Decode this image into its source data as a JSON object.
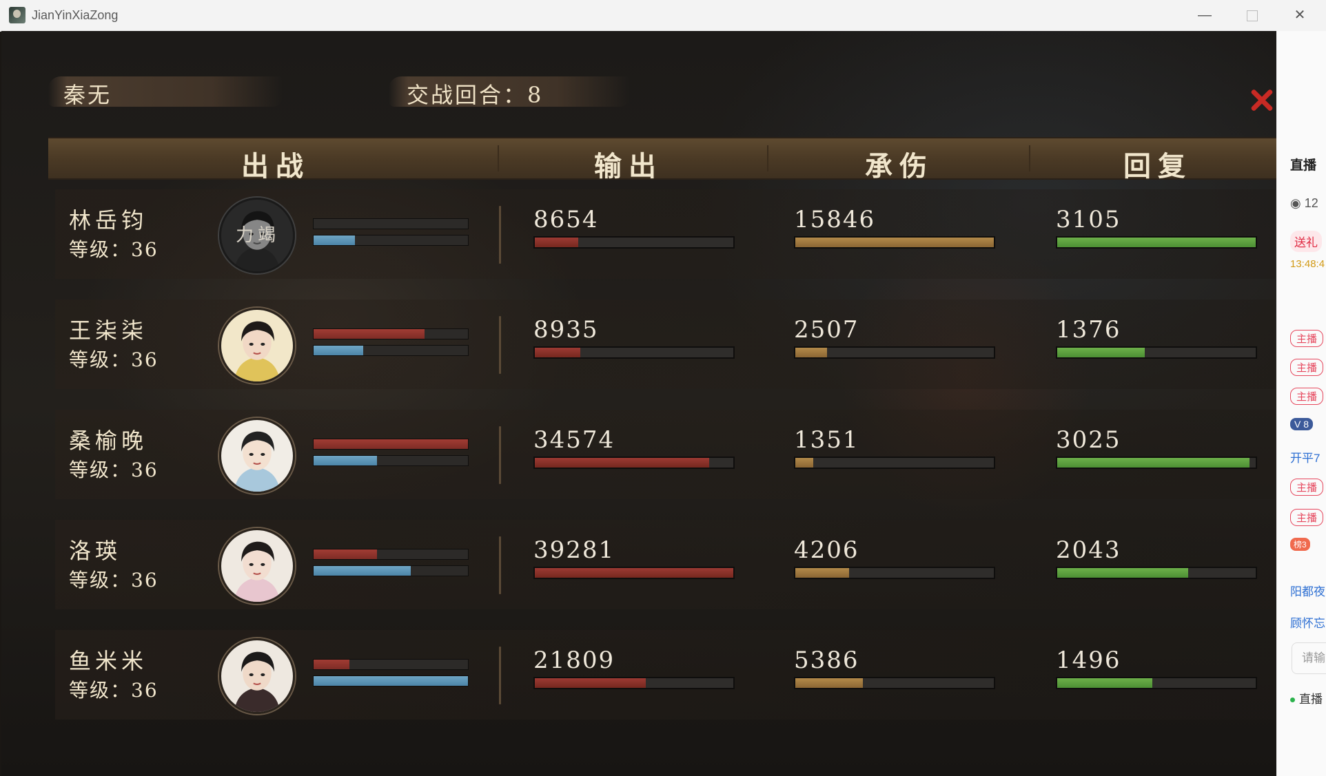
{
  "window": {
    "title": "JianYinXiaZong",
    "minimize": "—",
    "close": "✕"
  },
  "header": {
    "player_name": "秦无",
    "round_label": "交战回合：",
    "round_value": "8"
  },
  "columns": {
    "deploy": "出战",
    "output": "输出",
    "damage_taken": "承伤",
    "healing": "回复"
  },
  "rows": [
    {
      "name": "林岳钧",
      "level": "等级：36",
      "avatar_text": "力竭",
      "hp": 0.0,
      "mp": 0.27,
      "output": "8654",
      "output_pct": 0.22,
      "taken": "15846",
      "taken_pct": 1.0,
      "heal": "3105",
      "heal_pct": 1.0
    },
    {
      "name": "王柒柒",
      "level": "等级：36",
      "avatar_text": "",
      "hp": 0.72,
      "mp": 0.32,
      "output": "8935",
      "output_pct": 0.23,
      "taken": "2507",
      "taken_pct": 0.16,
      "heal": "1376",
      "heal_pct": 0.44
    },
    {
      "name": "桑榆晚",
      "level": "等级：36",
      "avatar_text": "",
      "hp": 1.0,
      "mp": 0.41,
      "output": "34574",
      "output_pct": 0.88,
      "taken": "1351",
      "taken_pct": 0.09,
      "heal": "3025",
      "heal_pct": 0.97
    },
    {
      "name": "洛瑛",
      "level": "等级：36",
      "avatar_text": "",
      "hp": 0.41,
      "mp": 0.63,
      "output": "39281",
      "output_pct": 1.0,
      "taken": "4206",
      "taken_pct": 0.27,
      "heal": "2043",
      "heal_pct": 0.66
    },
    {
      "name": "鱼米米",
      "level": "等级：36",
      "avatar_text": "",
      "hp": 0.23,
      "mp": 1.0,
      "output": "21809",
      "output_pct": 0.56,
      "taken": "5386",
      "taken_pct": 0.34,
      "heal": "1496",
      "heal_pct": 0.48
    }
  ],
  "footer_id": "4557558991762433",
  "side_panel": {
    "title": "直播",
    "views": "12",
    "gift": "送礼",
    "time": "13:48:4",
    "badges": [
      "主播",
      "主播",
      "主播",
      "主播",
      "主播"
    ],
    "vip": "8",
    "msg1": "开平7",
    "rank": "榜3",
    "msg2": "阳都夜",
    "msg3": "顾怀忘",
    "input_placeholder": "请输",
    "live": "直播"
  }
}
